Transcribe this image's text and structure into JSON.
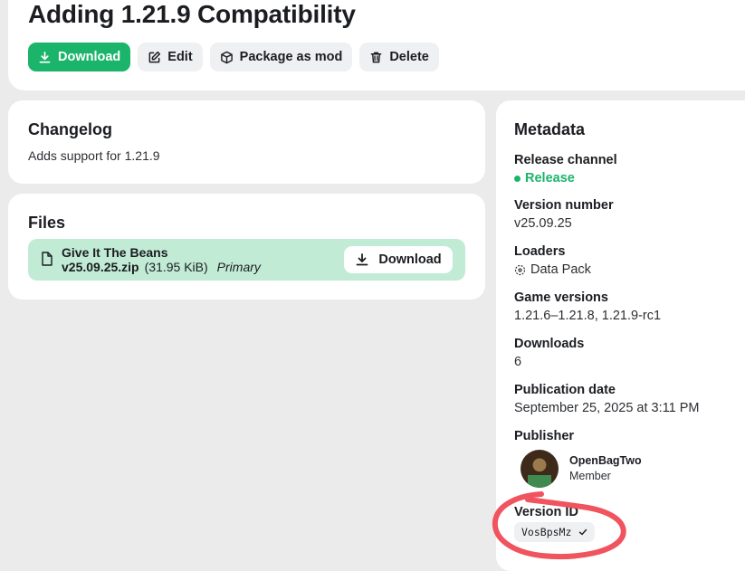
{
  "header": {
    "title": "Adding 1.21.9 Compatibility",
    "actions": {
      "download": "Download",
      "edit": "Edit",
      "package": "Package as mod",
      "delete": "Delete"
    }
  },
  "changelog": {
    "title": "Changelog",
    "text": "Adds support for 1.21.9"
  },
  "files": {
    "title": "Files",
    "file": {
      "name_line1": "Give It The Beans",
      "name_line2": "v25.09.25.zip",
      "size": "(31.95 KiB)",
      "tag": "Primary",
      "download_label": "Download"
    }
  },
  "metadata": {
    "title": "Metadata",
    "release_channel": {
      "label": "Release channel",
      "value": "Release"
    },
    "version_number": {
      "label": "Version number",
      "value": "v25.09.25"
    },
    "loaders": {
      "label": "Loaders",
      "value": "Data Pack"
    },
    "game_versions": {
      "label": "Game versions",
      "value": "1.21.6–1.21.8, 1.21.9-rc1"
    },
    "downloads": {
      "label": "Downloads",
      "value": "6"
    },
    "publication_date": {
      "label": "Publication date",
      "value": "September 25, 2025 at 3:11 PM"
    },
    "publisher": {
      "label": "Publisher",
      "name": "OpenBagTwo",
      "role": "Member"
    },
    "version_id": {
      "label": "Version ID",
      "value": "VosBpsMz"
    }
  },
  "colors": {
    "accent": "#1bb46b",
    "file_row": "#c2ebd6",
    "annotation": "#f0545e"
  }
}
